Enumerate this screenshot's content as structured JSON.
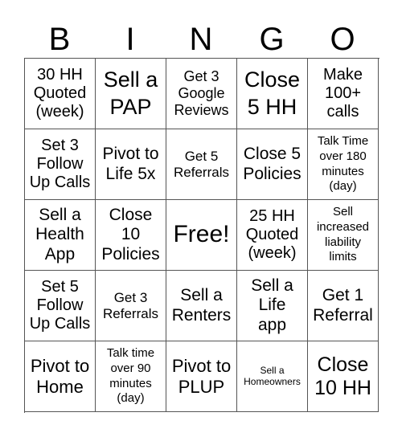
{
  "header": [
    "B",
    "I",
    "N",
    "G",
    "O"
  ],
  "cells": [
    "30 HH\nQuoted\n(week)",
    "Sell a\nPAP",
    "Get 3\nGoogle\nReviews",
    "Close\n5 HH",
    "Make\n100+\ncalls",
    "Set 3\nFollow\nUp Calls",
    "Pivot to\nLife 5x",
    "Get 5\nReferrals",
    "Close 5\nPolicies",
    "Talk Time\nover 180\nminutes\n(day)",
    "Sell a\nHealth\nApp",
    "Close\n10\nPolicies",
    "Free!",
    "25 HH\nQuoted\n(week)",
    "Sell\nincreased\nliability\nlimits",
    "Set 5\nFollow\nUp Calls",
    "Get 3\nReferrals",
    "Sell a\nRenters",
    "Sell a\nLife\napp",
    "Get 1\nReferral",
    "Pivot to\nHome",
    "Talk time\nover 90\nminutes\n(day)",
    "Pivot to\nPLUP",
    "Sell a\nHomeowners",
    "Close\n10 HH"
  ]
}
